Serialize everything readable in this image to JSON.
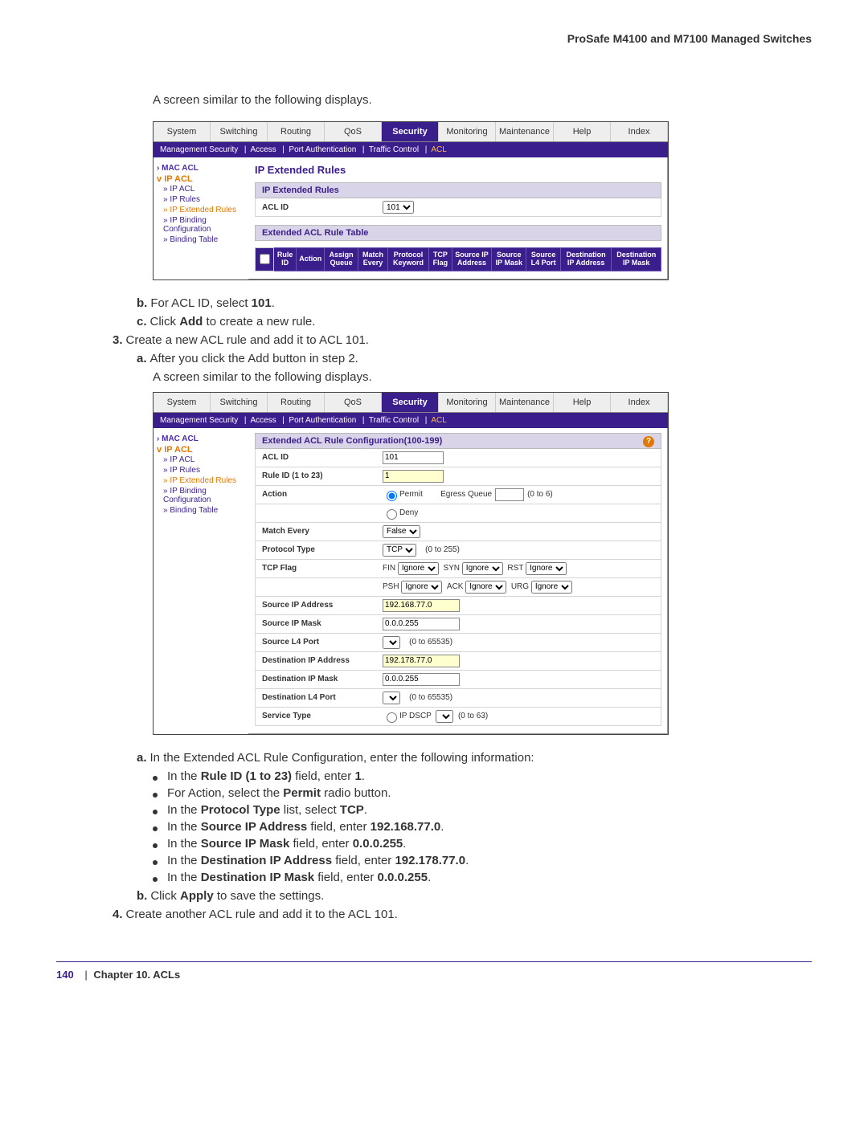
{
  "header": {
    "title": "ProSafe M4100 and M7100 Managed Switches"
  },
  "lines": {
    "intro1": "A screen similar to the following displays.",
    "b": "For ACL ID, select ",
    "b_val": "101",
    "c_pre": "Click ",
    "c_bold": "Add",
    "c_post": " to create a new rule.",
    "step3": "Create a new ACL rule and add it to ACL 101.",
    "s3a": "After you click the Add button in step 2.",
    "intro2": "A screen similar to the following displays.",
    "cfg_a": "In the Extended ACL Rule Configuration, enter the following information:",
    "bul1_pre": "In the ",
    "bul1_bold": "Rule ID (1 to 23)",
    "bul1_post": " field, enter ",
    "bul1_val": "1",
    "bul2_pre": "For Action, select the ",
    "bul2_bold": "Permit",
    "bul2_post": " radio button.",
    "bul3_pre": "In the ",
    "bul3_bold": "Protocol Type",
    "bul3_mid": " list, select ",
    "bul3_val": "TCP",
    "bul4_pre": "In the ",
    "bul4_bold": "Source IP Address",
    "bul4_post": " field, enter ",
    "bul4_val": "192.168.77.0",
    "bul5_pre": "In the ",
    "bul5_bold": "Source IP Mask",
    "bul5_post": " field, enter ",
    "bul5_val": "0.0.0.255",
    "bul6_pre": "In the ",
    "bul6_bold": "Destination IP Address",
    "bul6_post": " field, enter ",
    "bul6_val": "192.178.77.0",
    "bul7_pre": "In the ",
    "bul7_bold": "Destination IP Mask",
    "bul7_post": " field, enter ",
    "bul7_val": "0.0.0.255",
    "apply_b_pre": "Click ",
    "apply_b_bold": "Apply",
    "apply_b_post": " to save the settings.",
    "step4": "Create another ACL rule and add it to the ACL 101."
  },
  "footer": {
    "page": "140",
    "sep": "|",
    "chapter": "Chapter 10.  ACLs"
  },
  "ui_common": {
    "tabs": [
      "System",
      "Switching",
      "Routing",
      "QoS",
      "Security",
      "Monitoring",
      "Maintenance",
      "Help",
      "Index"
    ],
    "subbar": [
      "Management Security",
      "Access",
      "Port Authentication",
      "Traffic Control",
      "ACL"
    ],
    "sidebar_mac": "MAC ACL",
    "sidebar_ip_hdr": "IP ACL",
    "sidebar_items": [
      "IP ACL",
      "IP Rules",
      "IP Extended Rules",
      "IP Binding Configuration",
      "Binding Table"
    ]
  },
  "ui1": {
    "title": "IP Extended Rules",
    "panel_hdr": "IP Extended Rules",
    "aclid_label": "ACL ID",
    "aclid_value": "101",
    "rule_table_hdr": "Extended ACL Rule Table",
    "cols": [
      "Rule ID",
      "Action",
      "Assign Queue",
      "Match Every",
      "Protocol Keyword",
      "TCP Flag",
      "Source IP Address",
      "Source IP Mask",
      "Source L4 Port",
      "Destination IP Address",
      "Destination IP Mask"
    ]
  },
  "ui2": {
    "panel_hdr": "Extended ACL Rule Configuration(100-199)",
    "rows": {
      "aclid_l": "ACL ID",
      "aclid_v": "101",
      "ruleid_l": "Rule ID (1 to 23)",
      "ruleid_v": "1",
      "action_l": "Action",
      "permit": "Permit",
      "deny": "Deny",
      "egress_q_l": "Egress Queue",
      "egress_range": "(0 to 6)",
      "match_l": "Match Every",
      "match_v": "False",
      "proto_l": "Protocol Type",
      "proto_v": "TCP",
      "proto_range": "(0 to 255)",
      "tcpflag_l": "TCP Flag",
      "flag_fin": "FIN",
      "flag_syn": "SYN",
      "flag_rst": "RST",
      "flag_psh": "PSH",
      "flag_ack": "ACK",
      "flag_urg": "URG",
      "ignore": "Ignore",
      "sip_l": "Source IP Address",
      "sip_v": "192.168.77.0",
      "smask_l": "Source IP Mask",
      "smask_v": "0.0.0.255",
      "sl4_l": "Source L4 Port",
      "sl4_range": "(0 to 65535)",
      "dip_l": "Destination IP Address",
      "dip_v": "192.178.77.0",
      "dmask_l": "Destination IP Mask",
      "dmask_v": "0.0.0.255",
      "dl4_l": "Destination L4 Port",
      "dl4_range": "(0 to 65535)",
      "svc_l": "Service Type",
      "svc_opt": "IP DSCP",
      "svc_range": "(0 to 63)"
    }
  }
}
